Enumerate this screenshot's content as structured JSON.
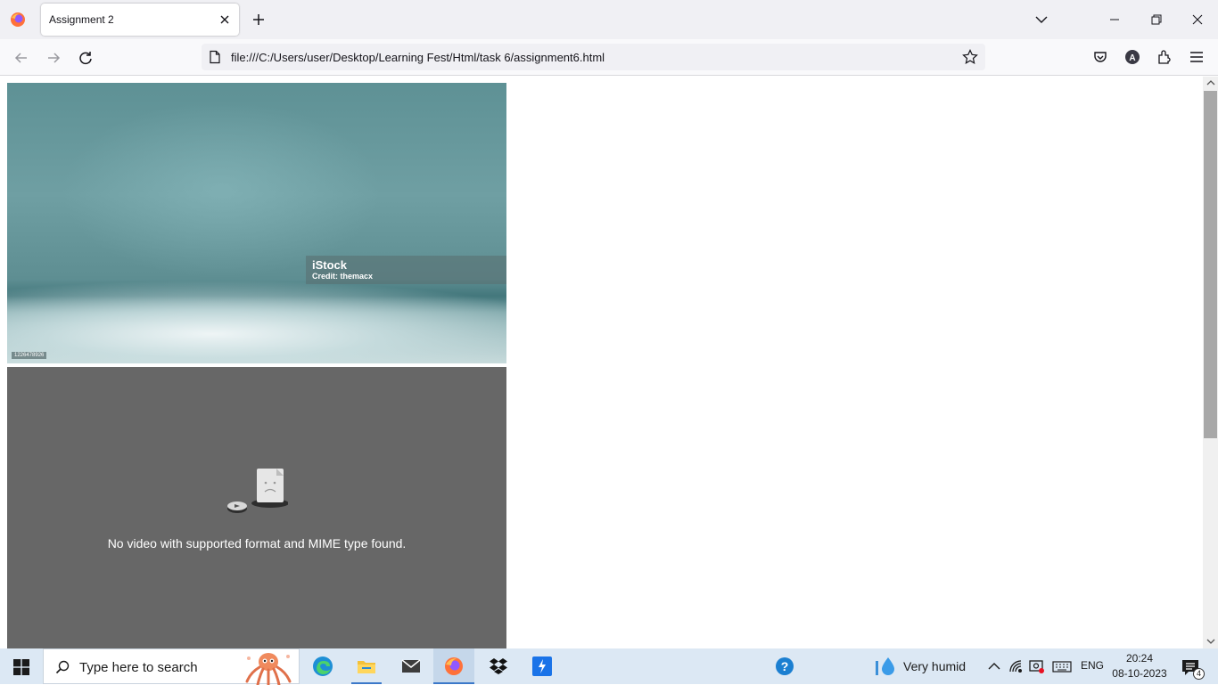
{
  "browser": {
    "tab": {
      "title": "Assignment 2"
    },
    "url": "file:///C:/Users/user/Desktop/Learning Fest/Html/task 6/assignment6.html"
  },
  "page": {
    "image": {
      "brand": "iStock",
      "credit": "Credit: themacx",
      "stock_id": "1226478926"
    },
    "video": {
      "error_message": "No video with supported format and MIME type found."
    }
  },
  "taskbar": {
    "search_placeholder": "Type here to search",
    "weather": "Very humid",
    "language": "ENG",
    "time": "20:24",
    "date": "08-10-2023",
    "notification_count": "4"
  },
  "colors": {
    "video_bg": "#676767",
    "taskbar_bg": "#dce8f4",
    "tab_bar_bg": "#f0f0f4"
  }
}
